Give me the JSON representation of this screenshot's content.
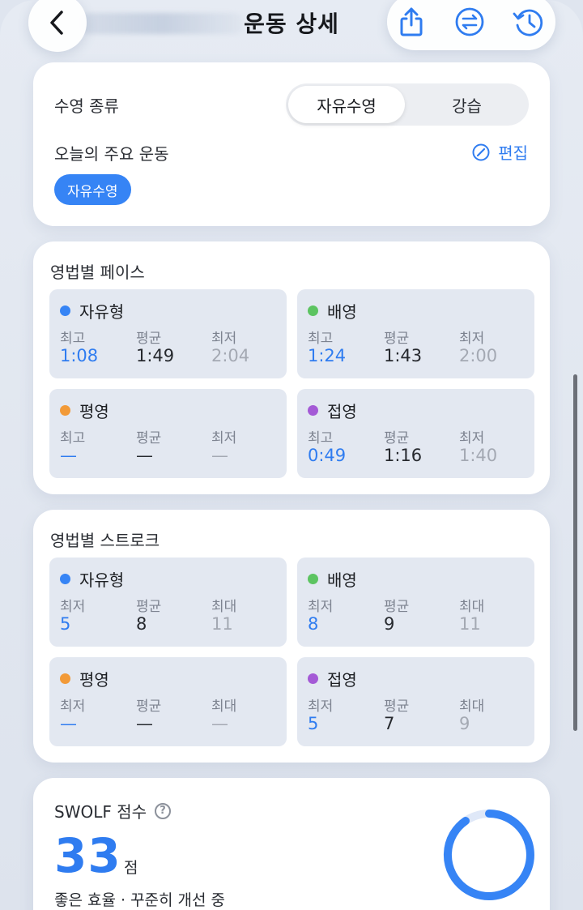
{
  "header": {
    "title": "운동 상세"
  },
  "swim_type": {
    "label": "수영 종류",
    "options": [
      "자유수영",
      "강습"
    ],
    "selected": "자유수영"
  },
  "main_workout": {
    "label": "오늘의 주요 운동",
    "edit_label": "편집",
    "chip": "자유수영"
  },
  "pace": {
    "title": "영법별 페이스",
    "strokes": [
      {
        "name": "자유형",
        "color": "#3684f5",
        "h1": "최고",
        "h2": "평균",
        "h3": "최저",
        "v1": "1:08",
        "v2": "1:49",
        "v3": "2:04"
      },
      {
        "name": "배영",
        "color": "#5cc461",
        "h1": "최고",
        "h2": "평균",
        "h3": "최저",
        "v1": "1:24",
        "v2": "1:43",
        "v3": "2:00"
      },
      {
        "name": "평영",
        "color": "#f29a38",
        "h1": "최고",
        "h2": "평균",
        "h3": "최저",
        "v1": "—",
        "v2": "—",
        "v3": "—"
      },
      {
        "name": "접영",
        "color": "#a45ad6",
        "h1": "최고",
        "h2": "평균",
        "h3": "최저",
        "v1": "0:49",
        "v2": "1:16",
        "v3": "1:40"
      }
    ]
  },
  "stroke": {
    "title": "영법별 스트로크",
    "strokes": [
      {
        "name": "자유형",
        "color": "#3684f5",
        "h1": "최저",
        "h2": "평균",
        "h3": "최대",
        "v1": "5",
        "v2": "8",
        "v3": "11"
      },
      {
        "name": "배영",
        "color": "#5cc461",
        "h1": "최저",
        "h2": "평균",
        "h3": "최대",
        "v1": "8",
        "v2": "9",
        "v3": "11"
      },
      {
        "name": "평영",
        "color": "#f29a38",
        "h1": "최저",
        "h2": "평균",
        "h3": "최대",
        "v1": "—",
        "v2": "—",
        "v3": "—"
      },
      {
        "name": "접영",
        "color": "#a45ad6",
        "h1": "최저",
        "h2": "평균",
        "h3": "최대",
        "v1": "5",
        "v2": "7",
        "v3": "9"
      }
    ]
  },
  "swolf": {
    "title": "SWOLF 점수",
    "score": "33",
    "unit": "점",
    "description": "좋은 효율 · 꾸준히 개선 중",
    "ring_color": "#3684f5"
  },
  "icons": [
    "chevron-left-icon",
    "share-icon",
    "swap-icon",
    "history-icon",
    "edit-icon",
    "help-icon"
  ]
}
